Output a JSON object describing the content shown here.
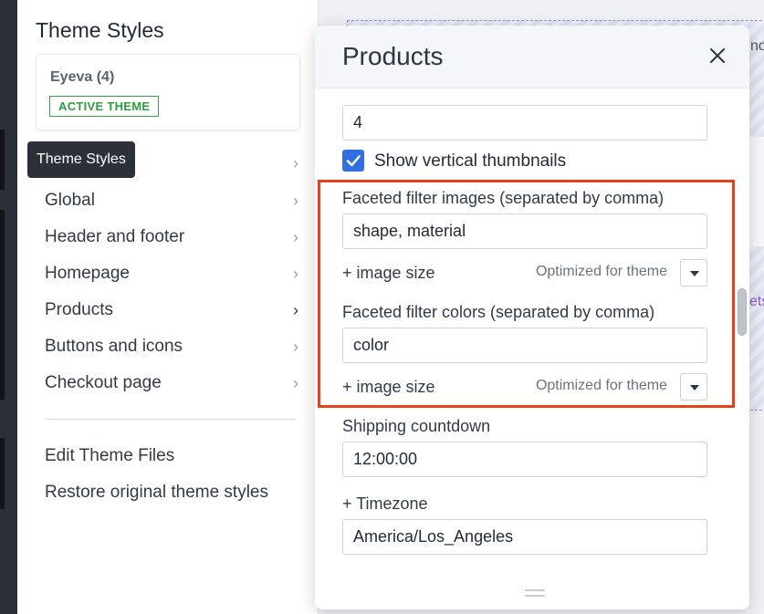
{
  "sidebar": {
    "title": "Theme Styles",
    "theme_card": {
      "name": "Eyeva (4)",
      "badge": "ACTIVE THEME"
    },
    "tooltip": "Theme Styles",
    "items": [
      {
        "label": "Global"
      },
      {
        "label": "Header and footer"
      },
      {
        "label": "Homepage"
      },
      {
        "label": "Products"
      },
      {
        "label": "Buttons and icons"
      },
      {
        "label": "Checkout page"
      }
    ],
    "links": [
      {
        "label": "Edit Theme Files"
      },
      {
        "label": "Restore original theme styles"
      }
    ]
  },
  "preview": {
    "text_top": "no",
    "text_mid": "ets"
  },
  "modal": {
    "title": "Products",
    "thumbnails_count": "4",
    "show_vertical_thumbnails": {
      "label": "Show vertical thumbnails",
      "checked": true
    },
    "faceted_images": {
      "label": "Faceted filter images (separated by comma)",
      "value": "shape, material",
      "size_label": "+ image size",
      "size_value": "Optimized for theme"
    },
    "faceted_colors": {
      "label": "Faceted filter colors (separated by comma)",
      "value": "color",
      "size_label": "+ image size",
      "size_value": "Optimized for theme"
    },
    "shipping": {
      "label": "Shipping countdown",
      "value": "12:00:00"
    },
    "timezone": {
      "label": "+ Timezone",
      "value": "America/Los_Angeles"
    }
  },
  "colors": {
    "accent_blue": "#2f6fe0",
    "badge_green": "#2f9a40",
    "highlight_red": "#e8401c"
  }
}
